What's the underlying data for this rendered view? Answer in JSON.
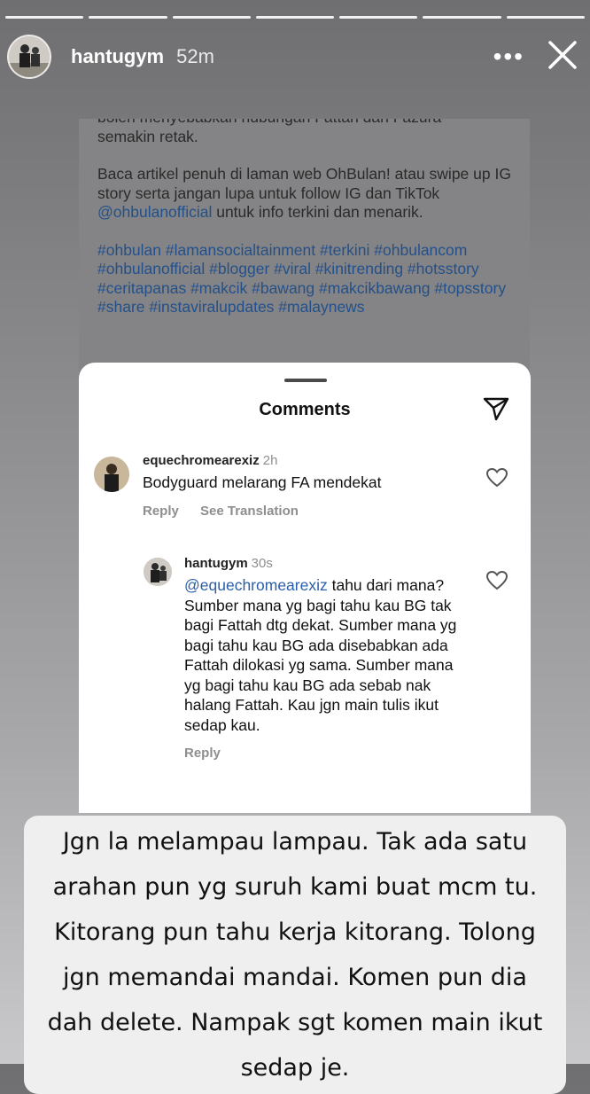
{
  "story": {
    "username": "hantugym",
    "time": "52m",
    "progress_segments": 7
  },
  "post": {
    "line_cut": "boleh menyebabkan hubungan Fattah dan Fazura",
    "para1_end": "semakin retak.",
    "para2_prefix": "Baca artikel penuh di laman web OhBulan! atau swipe up IG story serta jangan lupa untuk follow IG dan TikTok ",
    "para2_mention": "@ohbulanofficial",
    "para2_suffix": " untuk info terkini dan menarik.",
    "hashtags": "#ohbulan #lamansocialtainment #terkini #ohbulancom #ohbulanofficial #blogger #viral #kinitrending #hotsstory #ceritapanas #makcik #bawang #makcikbawang #topsstory #share #instaviralupdates #malaynews"
  },
  "sheet": {
    "title": "Comments",
    "comments": [
      {
        "user": "equechromearexiz",
        "time": "2h",
        "text": "Bodyguard melarang FA mendekat",
        "reply_label": "Reply",
        "translate_label": "See Translation"
      }
    ],
    "reply": {
      "user": "hantugym",
      "time": "30s",
      "mention": "@equechromearexiz",
      "text": " tahu dari mana? Sumber mana yg bagi tahu kau BG tak bagi Fattah dtg dekat. Sumber mana yg bagi tahu kau BG ada disebabkan ada Fattah dilokasi yg sama. Sumber mana yg bagi tahu kau BG ada sebab nak halang Fattah. Kau jgn main tulis ikut sedap kau.",
      "reply_label": "Reply"
    }
  },
  "caption": "Jgn la melampau lampau. Tak ada satu arahan pun yg suruh kami buat mcm tu. Kitorang pun tahu kerja kitorang. Tolong jgn memandai mandai. Komen pun dia dah delete.  Nampak sgt komen main ikut sedap je.",
  "colors": {
    "link": "#2b5ea8",
    "sheet_bg": "#ffffff",
    "caption_bg": "#efefef"
  }
}
